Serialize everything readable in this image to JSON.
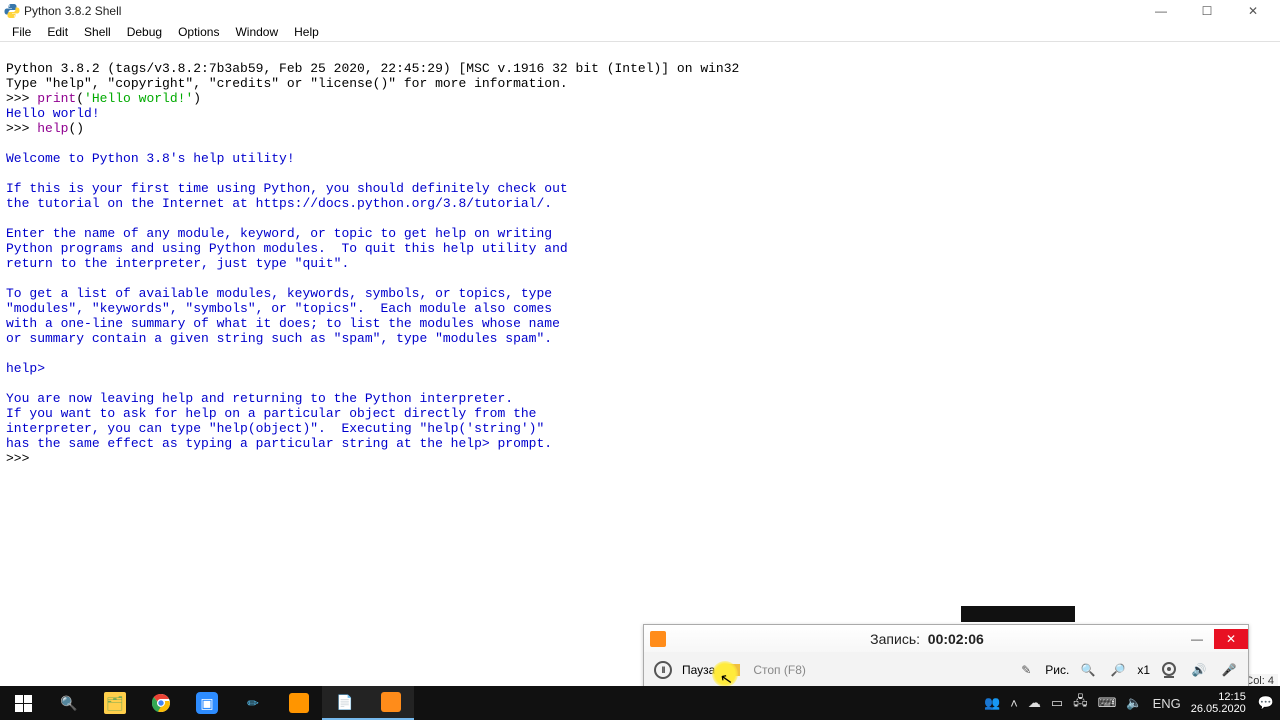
{
  "window": {
    "title": "Python 3.8.2 Shell",
    "win_min_glyph": "—",
    "win_max_glyph": "☐",
    "win_close_glyph": "✕"
  },
  "menu": {
    "items": [
      "File",
      "Edit",
      "Shell",
      "Debug",
      "Options",
      "Window",
      "Help"
    ]
  },
  "shell": {
    "banner1": "Python 3.8.2 (tags/v3.8.2:7b3ab59, Feb 25 2020, 22:45:29) [MSC v.1916 32 bit (Intel)] on win32",
    "banner2": "Type \"help\", \"copyright\", \"credits\" or \"license()\" for more information.",
    "prompt": ">>> ",
    "stmt1_func": "print",
    "stmt1_open": "(",
    "stmt1_str": "'Hello world!'",
    "stmt1_close": ")",
    "out1": "Hello world!",
    "stmt2_func": "help",
    "stmt2_parens": "()",
    "help_welcome": "Welcome to Python 3.8's help utility!",
    "help_p1": "If this is your first time using Python, you should definitely check out\nthe tutorial on the Internet at https://docs.python.org/3.8/tutorial/.",
    "help_p2": "Enter the name of any module, keyword, or topic to get help on writing\nPython programs and using Python modules.  To quit this help utility and\nreturn to the interpreter, just type \"quit\".",
    "help_p3": "To get a list of available modules, keywords, symbols, or topics, type\n\"modules\", \"keywords\", \"symbols\", or \"topics\".  Each module also comes\nwith a one-line summary of what it does; to list the modules whose name\nor summary contain a given string such as \"spam\", type \"modules spam\".",
    "help_prompt": "help> ",
    "help_exit1": "You are now leaving help and returning to the Python interpreter.",
    "help_exit2": "If you want to ask for help on a particular object directly from the\ninterpreter, you can type \"help(object)\".  Executing \"help('string')\"\nhas the same effect as typing a particular string at the help> prompt."
  },
  "status": {
    "col": "Col: 4"
  },
  "recorder": {
    "rec_label": "Запись:",
    "timer": "00:02:06",
    "pause": "Пауза",
    "stop": "Стоп",
    "stop_key": "(F8)",
    "draw": "Рис.",
    "zoom": "x1",
    "min_glyph": "—",
    "close_glyph": "✕"
  },
  "taskbar": {
    "lang": "ENG",
    "time": "12:15",
    "date": "26.05.2020"
  }
}
